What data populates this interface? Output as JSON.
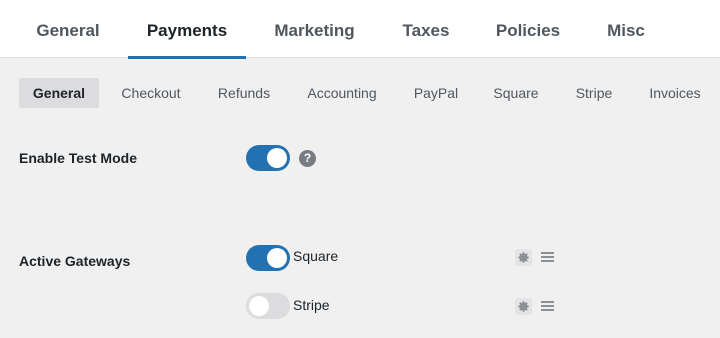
{
  "top_tabs": [
    "General",
    "Payments",
    "Marketing",
    "Taxes",
    "Policies",
    "Misc"
  ],
  "top_tab_active": "Payments",
  "sub_tabs": [
    "General",
    "Checkout",
    "Refunds",
    "Accounting",
    "PayPal",
    "Square",
    "Stripe",
    "Invoices"
  ],
  "sub_tab_active": "General",
  "test_mode": {
    "label": "Enable Test Mode",
    "enabled": true,
    "help_icon": "question-mark-icon",
    "help_glyph": "?"
  },
  "active_gateways": {
    "label": "Active Gateways",
    "gateways": [
      {
        "name": "Square",
        "enabled": true,
        "settings_icon": "gear-icon",
        "drag_icon": "drag-handle-icon"
      },
      {
        "name": "Stripe",
        "enabled": false,
        "settings_icon": "gear-icon",
        "drag_icon": "drag-handle-icon"
      }
    ]
  },
  "colors": {
    "accent": "#2271b1",
    "background": "#f0f0f1",
    "toggle_off": "#dcdcde"
  }
}
